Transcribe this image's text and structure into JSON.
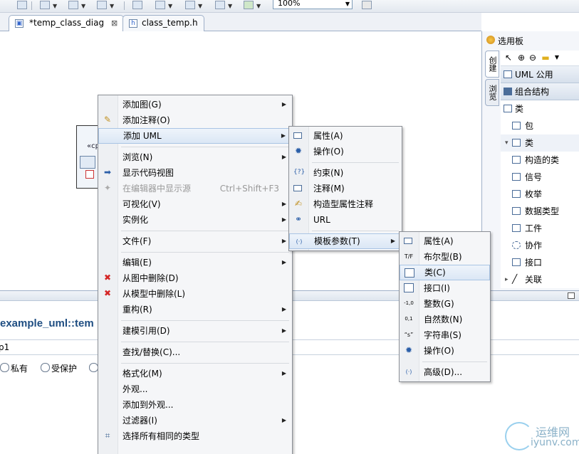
{
  "toolbar": {
    "zoom_value": "100%",
    "icons": [
      "save-icon",
      "layout-icon",
      "align-icon",
      "distribute-icon",
      "select-icon",
      "box-icon",
      "table-icon",
      "people-icon",
      "pin-icon"
    ]
  },
  "editor_tabs": [
    {
      "label": "*temp_class_diag",
      "active": true,
      "icon": "diagram-icon"
    },
    {
      "label": "class_temp.h",
      "active": false,
      "icon": "header-file-icon"
    }
  ],
  "canvas": {
    "shape_label": "«cp"
  },
  "palette": {
    "title": "选用板",
    "tabs": [
      "创建",
      "浏览"
    ],
    "drawers": [
      {
        "label": "UML 公用"
      },
      {
        "label": "组合结构"
      }
    ],
    "items": [
      {
        "label": "类",
        "level": 0
      },
      {
        "label": "包",
        "level": 1
      },
      {
        "label": "类",
        "level": 1,
        "expandable": true
      },
      {
        "label": "构造的类",
        "level": 2
      },
      {
        "label": "信号",
        "level": 2
      },
      {
        "label": "枚举",
        "level": 2
      },
      {
        "label": "数据类型",
        "level": 2
      },
      {
        "label": "工件",
        "level": 2
      },
      {
        "label": "协作",
        "level": 2
      },
      {
        "label": "接口",
        "level": 1
      },
      {
        "label": "关联",
        "level": 1,
        "expandable": true
      }
    ]
  },
  "properties": {
    "title": "example_uml::tem",
    "field_value": "p1",
    "radios": [
      "私有",
      "受保护",
      ""
    ]
  },
  "context_menu": {
    "items": [
      {
        "label": "添加图(G)",
        "submenu": true
      },
      {
        "label": "添加注释(O)",
        "icon": "note-icon"
      },
      {
        "label": "添加 UML",
        "submenu": true,
        "highlighted": true
      },
      {
        "separator": true
      },
      {
        "label": "浏览(N)",
        "submenu": true
      },
      {
        "label": "显示代码视图",
        "icon": "code-view-icon"
      },
      {
        "label": "在编辑器中显示源",
        "shortcut": "Ctrl+Shift+F3",
        "disabled": true,
        "icon": "source-icon"
      },
      {
        "label": "可视化(V)",
        "submenu": true
      },
      {
        "label": "实例化",
        "submenu": true
      },
      {
        "separator": true
      },
      {
        "label": "文件(F)",
        "submenu": true
      },
      {
        "separator": true
      },
      {
        "label": "编辑(E)",
        "submenu": true
      },
      {
        "label": "从图中删除(D)",
        "icon": "delete-icon"
      },
      {
        "label": "从模型中删除(L)",
        "icon": "delete-icon"
      },
      {
        "label": "重构(R)",
        "submenu": true
      },
      {
        "separator": true
      },
      {
        "label": "建模引用(D)",
        "submenu": true
      },
      {
        "separator": true
      },
      {
        "label": "查找/替换(C)..."
      },
      {
        "separator": true
      },
      {
        "label": "格式化(M)",
        "submenu": true
      },
      {
        "label": "外观..."
      },
      {
        "label": "添加到外观..."
      },
      {
        "label": "过滤器(I)",
        "submenu": true
      },
      {
        "label": "选择所有相同的类型",
        "icon": "select-same-icon"
      }
    ]
  },
  "uml_submenu": {
    "items": [
      {
        "label": "属性(A)",
        "icon": "attribute-icon"
      },
      {
        "label": "操作(O)",
        "icon": "operation-icon"
      },
      {
        "separator": true
      },
      {
        "label": "约束(N)",
        "icon": "constraint-icon"
      },
      {
        "label": "注释(M)",
        "icon": "comment-icon"
      },
      {
        "label": "构造型属性注释",
        "icon": "stereotype-icon"
      },
      {
        "label": "URL",
        "icon": "url-icon"
      },
      {
        "separator": true
      },
      {
        "label": "模板参数(T)",
        "submenu": true,
        "highlighted": true,
        "icon": "template-param-icon"
      }
    ]
  },
  "template_submenu": {
    "items": [
      {
        "label": "属性(A)",
        "icon": "attribute-icon"
      },
      {
        "label": "布尔型(B)",
        "icon": "boolean-icon"
      },
      {
        "label": "类(C)",
        "icon": "class-icon",
        "highlighted": true
      },
      {
        "label": "接口(I)",
        "icon": "interface-icon"
      },
      {
        "label": "整数(G)",
        "icon": "integer-icon"
      },
      {
        "label": "自然数(N)",
        "icon": "natural-icon"
      },
      {
        "label": "字符串(S)",
        "icon": "string-icon"
      },
      {
        "label": "操作(O)",
        "icon": "operation-icon"
      },
      {
        "separator": true
      },
      {
        "label": "高级(D)...",
        "icon": "advanced-icon"
      }
    ]
  },
  "watermark": {
    "cn": "运维网",
    "en": "iyunv.com"
  }
}
